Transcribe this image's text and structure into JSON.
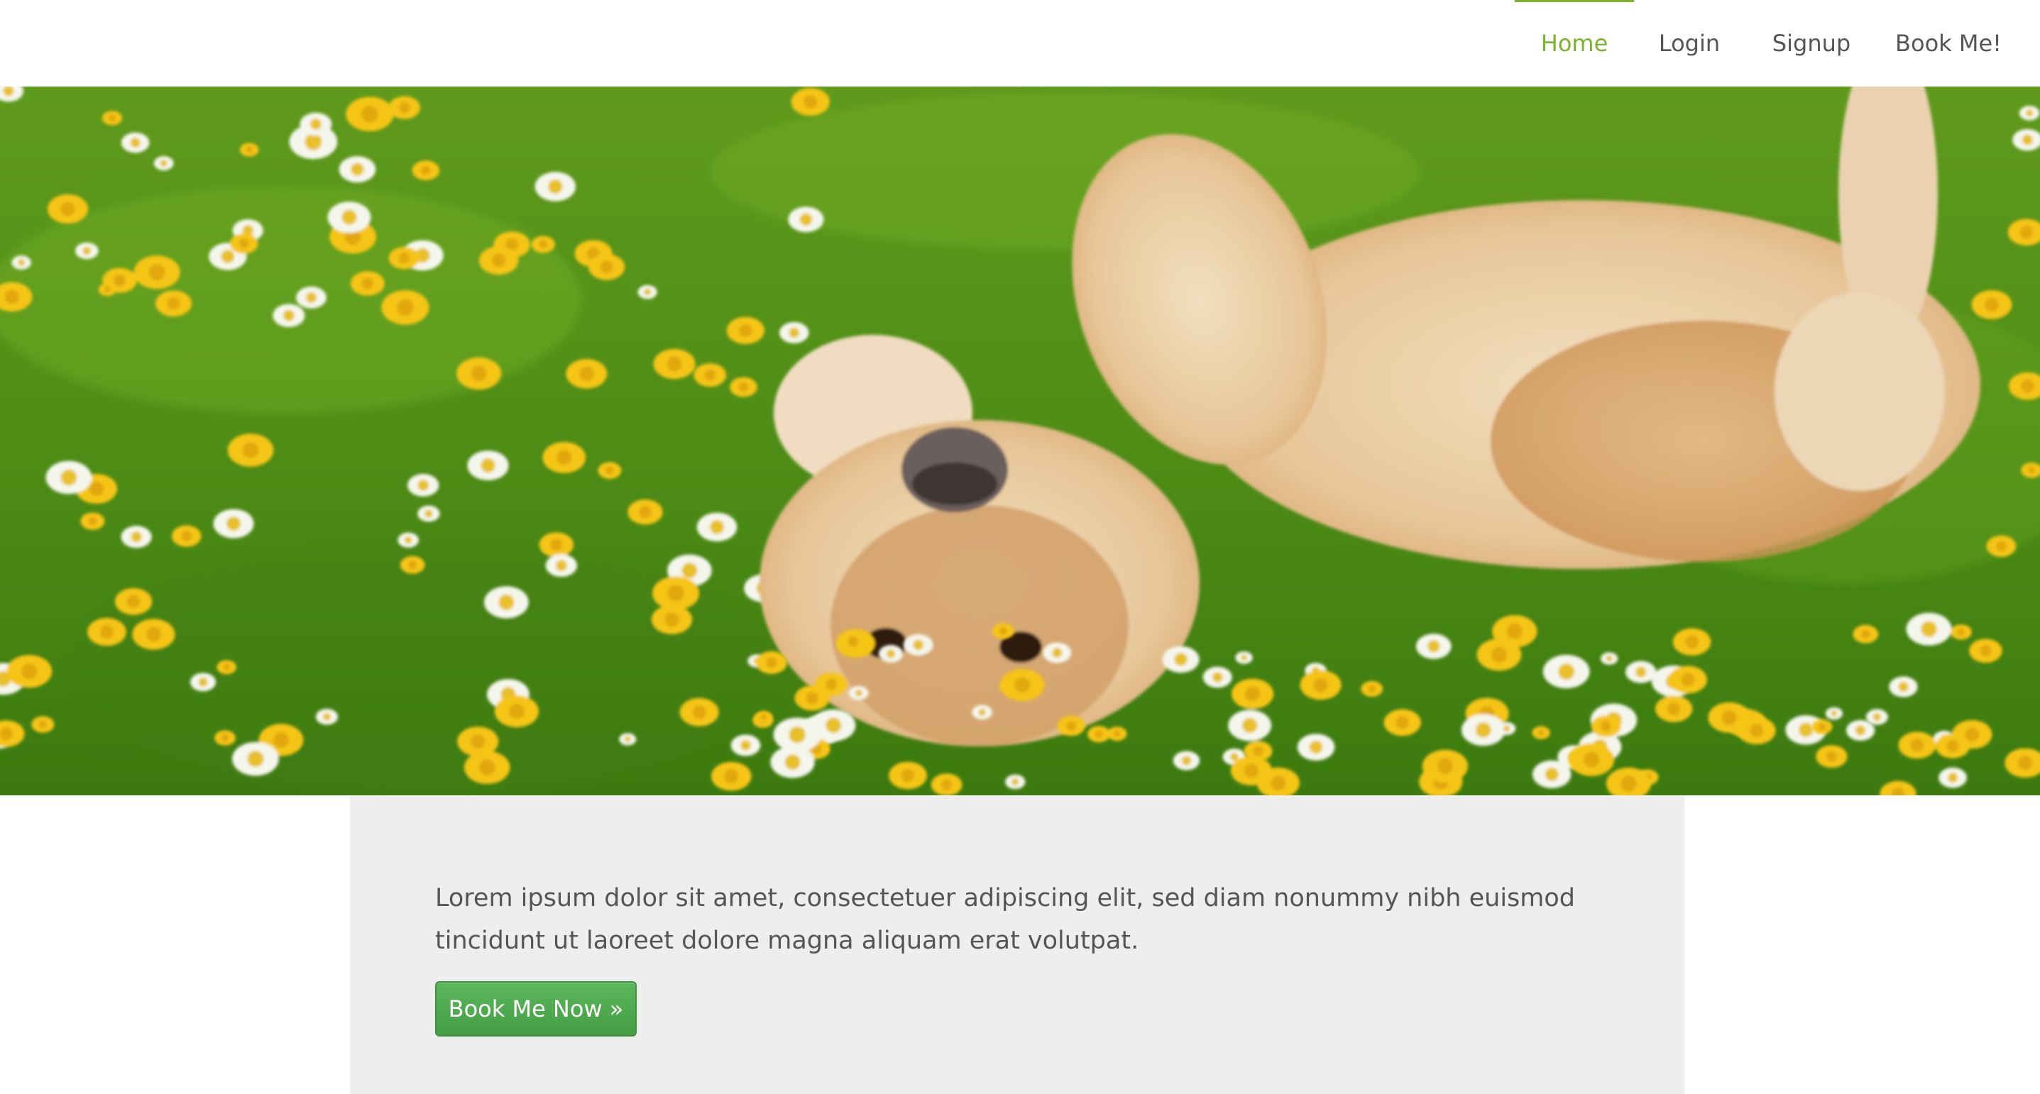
{
  "nav": {
    "items": [
      {
        "label": "Home",
        "active": true
      },
      {
        "label": "Login",
        "active": false
      },
      {
        "label": "Signup",
        "active": false
      },
      {
        "label": "Book Me!",
        "active": false
      }
    ]
  },
  "hero": {
    "image": "golden retriever rolling on its back in grass with dandelions and daisies"
  },
  "panel": {
    "text": "Lorem ipsum dolor sit amet, consectetuer adipiscing elit, sed diam nonummy nibh euismod tincidunt ut laoreet dolore magna aliquam erat volutpat.",
    "cta_label": "Book Me Now »"
  },
  "colors": {
    "accent": "#7ab32e",
    "button": "#5cb85c",
    "panel_bg": "#eeeeee",
    "text": "#555555"
  }
}
